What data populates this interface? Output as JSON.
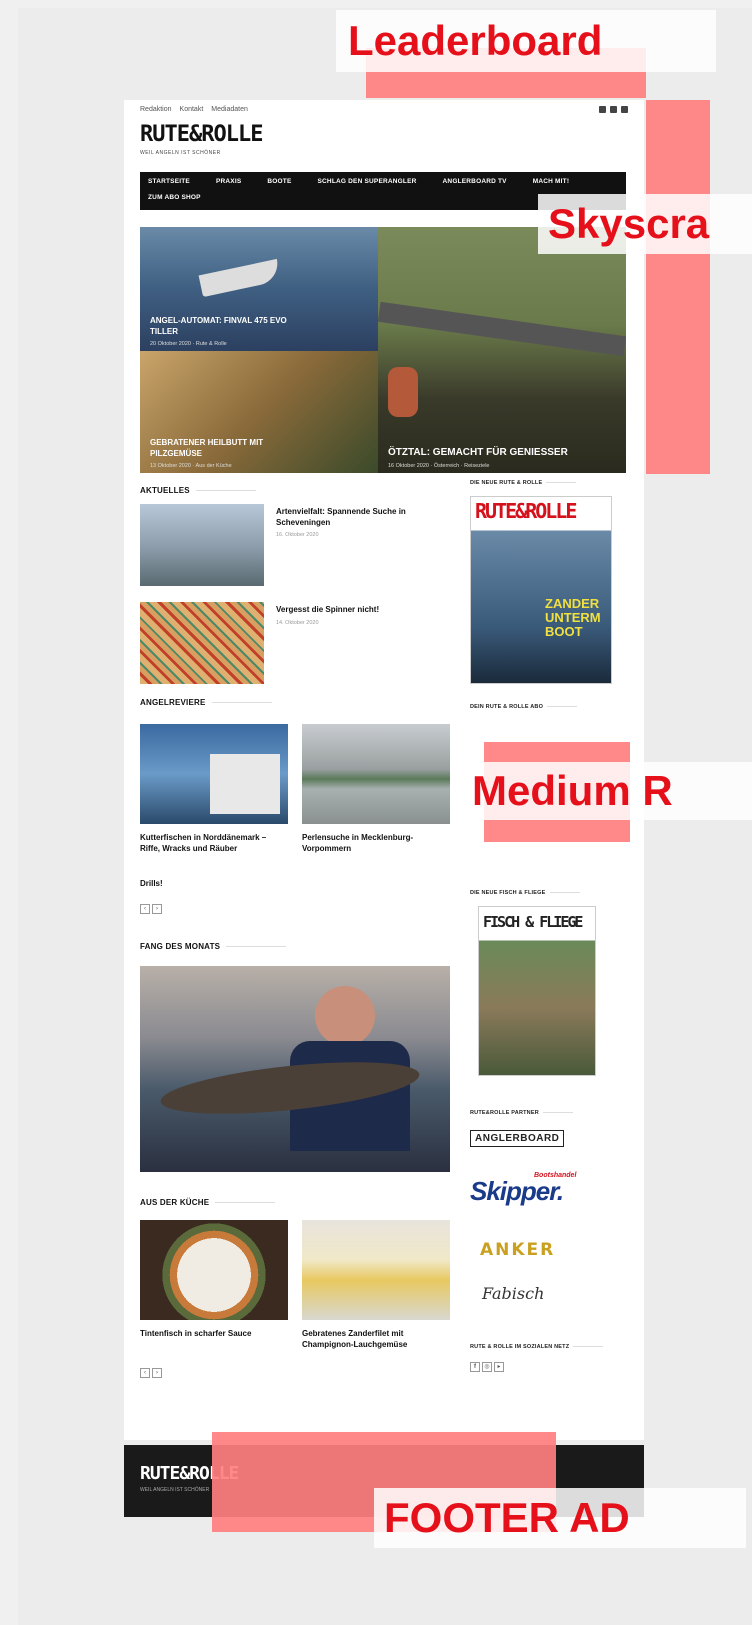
{
  "ads": {
    "leaderboard": "Leaderboard",
    "skyscraper": "Skyscra",
    "medium_rectangle": "Medium R",
    "footer": "FOOTER AD"
  },
  "topbar": {
    "links": [
      "Redaktion",
      "Kontakt",
      "Mediadaten"
    ]
  },
  "brand": {
    "logo": "RUTE&ROLLE",
    "tagline": "WEIL ANGELN IST SCHÖNER"
  },
  "nav": {
    "items": [
      "STARTSEITE",
      "PRAXIS",
      "BOOTE",
      "SCHLAG DEN SUPERANGLER",
      "ANGLERBOARD TV",
      "MACH MIT!",
      "ZUM ABO SHOP"
    ]
  },
  "hero": {
    "tiles": [
      {
        "title": "ANGEL-AUTOMAT: FINVAL 475 EVO TILLER",
        "meta": "20 Oktober 2020 · Rute & Rolle"
      },
      {
        "title": "GEBRATENER HEILBUTT MIT PILZGEMÜSE",
        "meta": "13 Oktober 2020 · Aus der Küche"
      },
      {
        "title": "ÖTZTAL: GEMACHT FÜR GENIESSER",
        "meta": "16 Oktober 2020 · Österreich · Reiseziele"
      }
    ]
  },
  "sections": {
    "aktuelles": "AKTUELLES",
    "angelreviere": "ANGELREVIERE",
    "fang": "FANG DES MONATS",
    "kueche": "AUS DER KÜCHE"
  },
  "aktuelles": [
    {
      "title": "Artenvielfalt: Spannende Suche in Scheveningen",
      "date": "16. Oktober 2020"
    },
    {
      "title": "Vergesst die Spinner nicht!",
      "date": "14. Oktober 2020"
    }
  ],
  "reviere": [
    {
      "title": "Kutterfischen in Norddänemark – Riffe, Wracks und Räuber"
    },
    {
      "title": "Perlensuche in Mecklenburg-Vorpommern"
    }
  ],
  "drills_label": "Drills!",
  "kueche": [
    {
      "title": "Tintenfisch in scharfer Sauce"
    },
    {
      "title": "Gebratenes Zanderfilet mit Champignon-Lauchgemüse"
    }
  ],
  "pager": {
    "prev": "‹",
    "next": "›"
  },
  "sidebar": {
    "neue_rute": "DIE NEUE RUTE & ROLLE",
    "abo": "DEIN RUTE & ROLLE ABO",
    "neue_fisch": "DIE NEUE FISCH & FLIEGE",
    "partner": "RUTE&ROLLE PARTNER",
    "social": "RUTE & ROLLE IM SOZIALEN NETZ",
    "mag1_title": "RUTE&ROLLE",
    "mag1_cover": "ZANDER UNTERM BOOT",
    "mag2_title": "FISCH & FLIEGE",
    "partners": [
      "ANGLERBOARD",
      "Skipper.",
      "Bootshandel",
      "ANKER",
      "Fabisch"
    ]
  },
  "footer": {
    "logo": "RUTE&ROLLE",
    "tagline": "WEIL ANGELN IST SCHÖNER"
  },
  "colors": {
    "ad_overlay": "#ff7f7f",
    "ad_text": "#e5101a",
    "nav_bg": "#111111"
  }
}
